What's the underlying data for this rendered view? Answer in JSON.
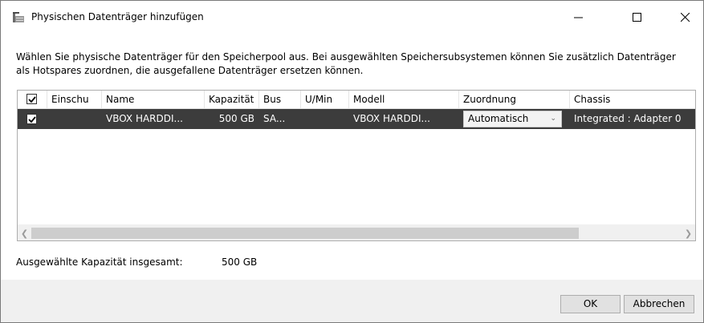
{
  "window": {
    "title": "Physischen Datenträger hinzufügen",
    "icon": "storage-pool-icon"
  },
  "instructions": "Wählen Sie physische Datenträger für den Speicherpool aus. Bei ausgewählten Speichersubsystemen können Sie zusätzlich Datenträger als Hotspares zuordnen, die ausgefallene Datenträger ersetzen können.",
  "table": {
    "select_all_checked": true,
    "columns": [
      "Einschu",
      "Name",
      "Kapazität",
      "Bus",
      "U/Min",
      "Modell",
      "Zuordnung",
      "Chassis"
    ],
    "rows": [
      {
        "checked": true,
        "einschub": "",
        "name": "VBOX HARDDI...",
        "kapazitaet": "500 GB",
        "bus": "SA...",
        "umin": "",
        "modell": "VBOX HARDDI...",
        "zuordnung": "Automatisch",
        "chassis": "Integrated : Adapter 0"
      }
    ]
  },
  "summary": {
    "label": "Ausgewählte Kapazität insgesamt:",
    "value": "500 GB"
  },
  "buttons": {
    "ok": "OK",
    "cancel": "Abbrechen"
  },
  "colors": {
    "selected_row": "#3c3c3c",
    "dialog_footer": "#f0f0f0"
  }
}
